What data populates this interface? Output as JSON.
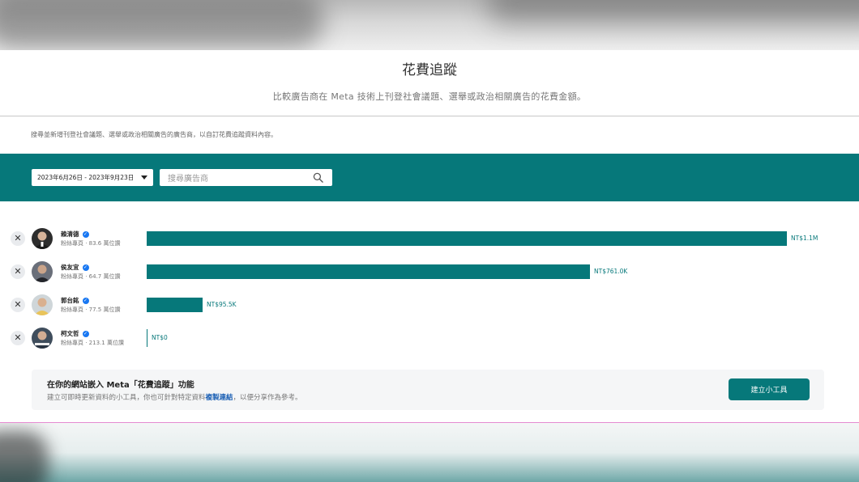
{
  "header": {
    "title": "花費追蹤",
    "subtitle": "比較廣告商在 Meta 技術上刊登社會議題、選舉或政治相關廣告的花費金額。"
  },
  "hint": "搜尋並新增刊登社會議題、選舉或政治相關廣告的廣告商，以自訂花費追蹤資料內容。",
  "filters": {
    "date_range": "2023年6月26日 - 2023年9月23日",
    "search_placeholder": "搜尋廣告商"
  },
  "advertisers": [
    {
      "name": "賴清德",
      "fans": "粉絲專頁 · 83.6 萬位讚",
      "spend_label": "NT$1.1M",
      "spend_value": 1100000
    },
    {
      "name": "侯友宜",
      "fans": "粉絲專頁 · 64.7 萬位讚",
      "spend_label": "NT$761.0K",
      "spend_value": 761000
    },
    {
      "name": "郭台銘",
      "fans": "粉絲專頁 · 77.5 萬位讚",
      "spend_label": "NT$95.5K",
      "spend_value": 95500
    },
    {
      "name": "柯文哲",
      "fans": "粉絲專頁 · 213.1 萬位讚",
      "spend_label": "NT$0",
      "spend_value": 0
    }
  ],
  "embed": {
    "title": "在你的網站嵌入 Meta「花費追蹤」功能",
    "desc_before": "建立可即時更新資料的小工具，你也可針對特定資料",
    "desc_link": "複製連結",
    "desc_after": "，以便分享作為參考。",
    "button_label": "建立小工具"
  },
  "colors": {
    "accent": "#06787a",
    "verified": "#1877f2"
  },
  "icons": {
    "remove": "close-icon",
    "search": "search-icon",
    "verified": "verified-badge-icon",
    "dropdown": "caret-down-icon"
  }
}
